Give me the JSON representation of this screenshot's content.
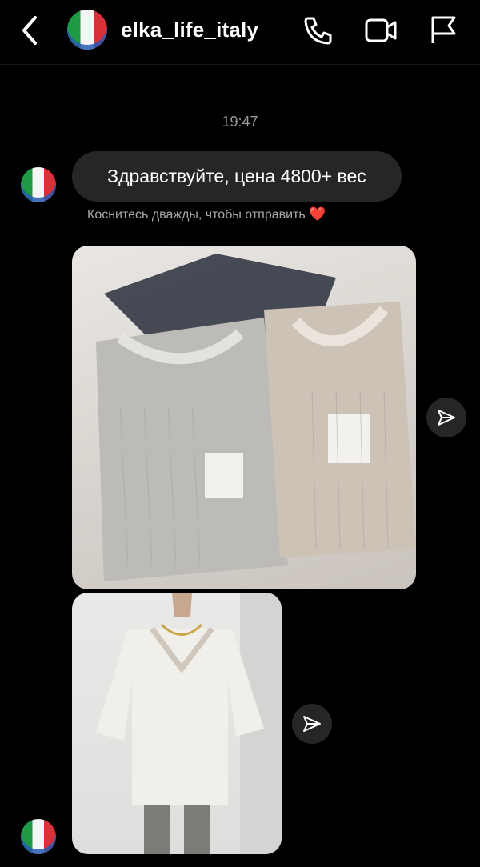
{
  "header": {
    "username": "elka_life_italy",
    "back_icon": "chevron-left-icon",
    "call_icon": "phone-icon",
    "video_icon": "video-camera-icon",
    "report_icon": "flag-icon"
  },
  "thread": {
    "timestamp": "19:47",
    "message_text": "Здравствуйте, цена 4800+ вес",
    "double_tap_hint": "Коснитесь дважды, чтобы отправить",
    "hint_emoji": "❤️"
  },
  "colors": {
    "background": "#000000",
    "bubble": "#262626",
    "muted_text": "#9a9a9a",
    "heart": "#e0313f"
  }
}
